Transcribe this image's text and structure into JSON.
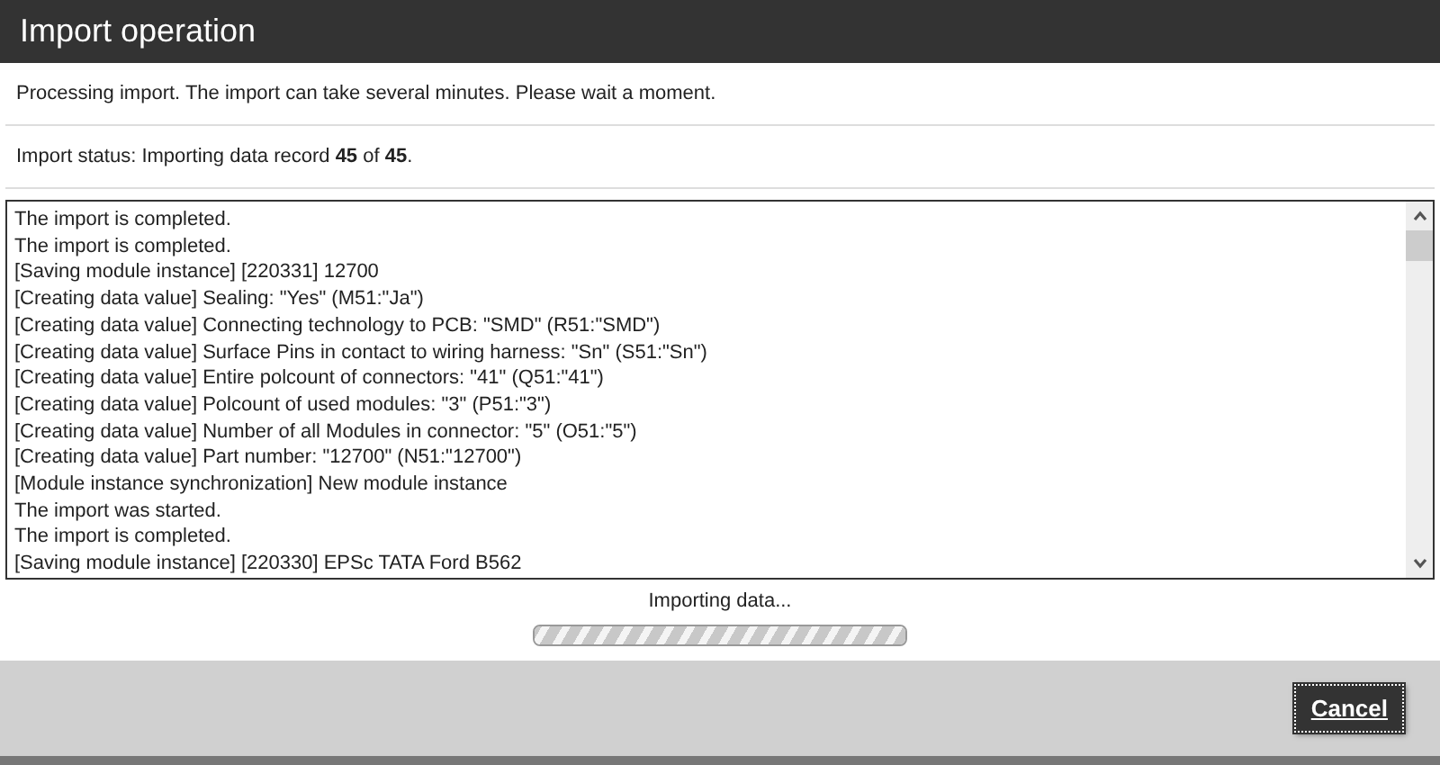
{
  "window": {
    "title": "Import operation"
  },
  "message": "Processing import. The import can take several minutes. Please wait a moment.",
  "status": "Import status: Importing data record **45** of **45**.",
  "log": [
    "The import is completed.",
    "The import is completed.",
    "[Saving module instance] [220331] 12700",
    "[Creating data value] Sealing: \"Yes\" (M51:\"Ja\")",
    "[Creating data value] Connecting technology to PCB: \"SMD\" (R51:\"SMD\")",
    "[Creating data value] Surface Pins in contact to wiring harness: \"Sn\" (S51:\"Sn\")",
    "[Creating data value] Entire polcount of connectors: \"41\" (Q51:\"41\")",
    "[Creating data value] Polcount of used modules: \"3\" (P51:\"3\")",
    "[Creating data value] Number of all Modules in connector: \"5\" (O51:\"5\")",
    "[Creating data value] Part number: \"12700\" (N51:\"12700\")",
    "[Module instance synchronization] New module instance",
    "The import was started.",
    "The import is completed.",
    "[Saving module instance] [220330] EPSc TATA Ford B562"
  ],
  "progress": {
    "label": "Importing data...",
    "level": 1
  },
  "buttons": [
    "Cancel"
  ]
}
